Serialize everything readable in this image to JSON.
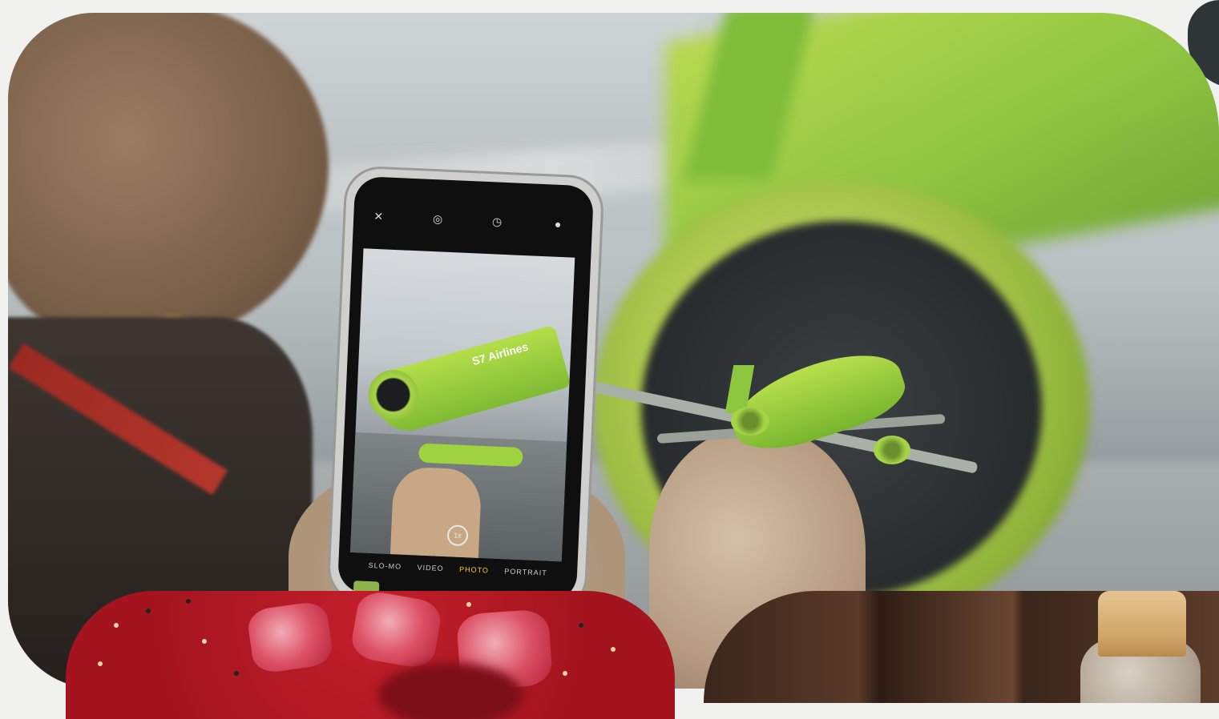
{
  "hero": {
    "alt": "Person photographing a green airliner with a smartphone while holding a toy plane model",
    "plane_livery_text": "S7 Airlines",
    "accent_color": "#8dc63f"
  },
  "phone_camera": {
    "modes": [
      "SLO-MO",
      "VIDEO",
      "PHOTO",
      "PORTRAIT"
    ],
    "active_mode": "PHOTO",
    "zoom": "1x"
  },
  "cards": [
    {
      "name": "red-petals-card",
      "color": "#b0161f"
    },
    {
      "name": "wood-bottle-card",
      "color": "#4e3323"
    }
  ]
}
